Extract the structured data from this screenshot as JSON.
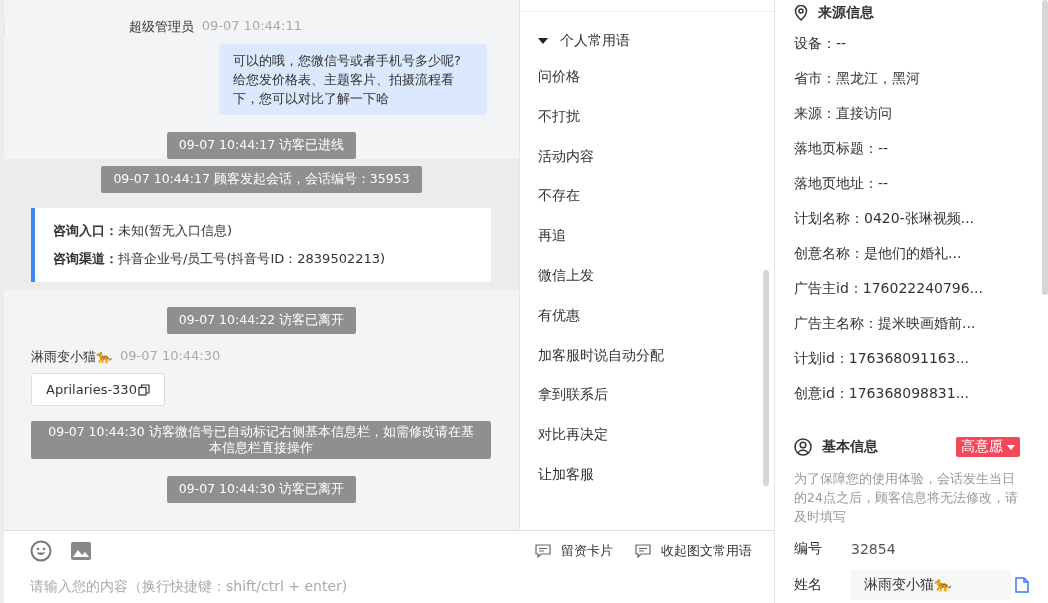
{
  "chat": {
    "messages": [
      {
        "kind": "agent",
        "sender": "超级管理员",
        "time": "09-07 10:44:11",
        "text": "可以的哦，您微信号或者手机号多少呢?给您发价格表、主题客片、拍摄流程看下，您可以对比了解一下哈"
      },
      {
        "kind": "system",
        "text": "09-07 10:44:17 访客已进线",
        "highlighted": false
      },
      {
        "kind": "system",
        "text": "09-07 10:44:17 顾客发起会话，会话编号：35953",
        "highlighted": true
      },
      {
        "kind": "info",
        "highlighted": true,
        "lines": [
          {
            "label": "咨询入口：",
            "value": "未知(暂无入口信息)"
          },
          {
            "label": "咨询渠道：",
            "value": "抖音企业号/员工号(抖音号ID：2839502213)"
          }
        ]
      },
      {
        "kind": "system",
        "text": "09-07 10:44:22 访客已离开",
        "highlighted": false
      },
      {
        "kind": "visitor",
        "sender": "淋雨变小猫🐆",
        "time": "09-07 10:44:30",
        "text": "Aprilaries-330"
      },
      {
        "kind": "wide",
        "text": "09-07 10:44:30 访客微信号已自动标记右侧基本信息栏，如需修改请在基本信息栏直接操作"
      },
      {
        "kind": "system",
        "text": "09-07 10:44:30 访客已离开",
        "highlighted": false
      }
    ],
    "input": {
      "placeholder": "请输入您的内容（换行快捷键：shift/ctrl + enter)"
    }
  },
  "phrases": {
    "group": {
      "label": "个人常用语",
      "expanded": true
    },
    "items": [
      "问价格",
      "不打扰",
      "活动内容",
      "不存在",
      "再追",
      "微信上发",
      "有优惠",
      "加客服时说自动分配",
      "拿到联系后",
      "对比再决定",
      "让加客服"
    ]
  },
  "toolbar": {
    "buttons": [
      "留资卡片",
      "收起图文常用语"
    ]
  },
  "source": {
    "title": "来源信息",
    "fields": [
      "设备：--",
      "省市：黑龙江，黑河",
      "来源：直接访问",
      "落地页标题：--",
      "落地页地址：--",
      "计划名称：0420-张琳视频...",
      "创意名称：是他们的婚礼...",
      "广告主id：176022240796...",
      "广告主名称：提米映画婚前...",
      "计划id：176368091163...",
      "创意id：176368098831..."
    ]
  },
  "basic": {
    "title": "基本信息",
    "intent": {
      "label": "高意愿",
      "color": "#f5475a"
    },
    "note": "为了保障您的使用体验，会话发生当日的24点之后，顾客信息将无法修改，请及时填写",
    "fields": [
      {
        "kind": "text",
        "label": "编号",
        "value": "32854"
      },
      {
        "kind": "input",
        "label": "姓名",
        "value": "淋雨变小猫🐆"
      }
    ]
  }
}
